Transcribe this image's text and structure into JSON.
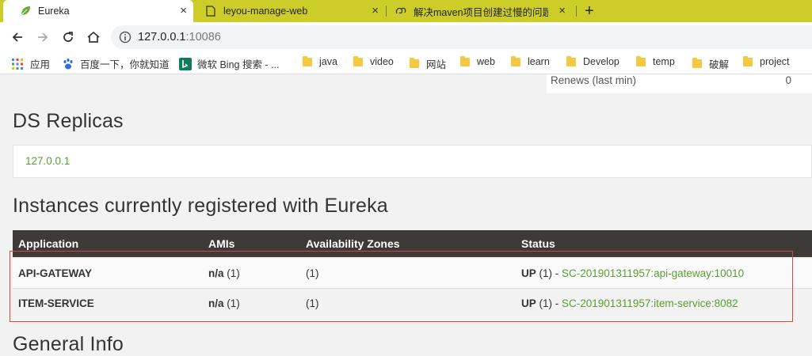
{
  "browser": {
    "tabs": [
      {
        "title": "Eureka",
        "icon": "eureka-leaf-icon",
        "active": true
      },
      {
        "title": "leyou-manage-web",
        "icon": "document-icon",
        "active": false
      },
      {
        "title": "解决maven项目创建过慢的问题",
        "icon": "swirl-icon",
        "active": false
      }
    ],
    "close_glyph": "×",
    "new_tab_glyph": "+",
    "url_host": "127.0.0.1",
    "url_port": ":10086"
  },
  "bookmarks": [
    {
      "label": "应用",
      "icon": "apps-grid-icon"
    },
    {
      "label": "百度一下，你就知道",
      "icon": "baidu-paw-icon"
    },
    {
      "label": "微软 Bing 搜索 - ...",
      "icon": "bing-icon"
    },
    {
      "label": "java",
      "icon": "folder-icon"
    },
    {
      "label": "video",
      "icon": "folder-icon"
    },
    {
      "label": "网站",
      "icon": "folder-icon"
    },
    {
      "label": "web",
      "icon": "folder-icon"
    },
    {
      "label": "learn",
      "icon": "folder-icon"
    },
    {
      "label": "Develop",
      "icon": "folder-icon"
    },
    {
      "label": "temp",
      "icon": "folder-icon"
    },
    {
      "label": "破解",
      "icon": "folder-icon"
    },
    {
      "label": "project",
      "icon": "folder-icon"
    }
  ],
  "stats": {
    "label": "Renews (last min)",
    "value": "0"
  },
  "replicas": {
    "title": "DS Replicas",
    "link": "127.0.0.1"
  },
  "instances": {
    "title": "Instances currently registered with Eureka",
    "headers": [
      "Application",
      "AMIs",
      "Availability Zones",
      "Status"
    ],
    "rows": [
      {
        "app": "API-GATEWAY",
        "ami": "n/a",
        "ami_count": " (1)",
        "zones": "(1)",
        "status": "UP",
        "status_count": " (1) - ",
        "instance": "SC-201901311957:api-gateway:10010"
      },
      {
        "app": "ITEM-SERVICE",
        "ami": "n/a",
        "ami_count": " (1)",
        "zones": "(1)",
        "status": "UP",
        "status_count": " (1) - ",
        "instance": "SC-201901311957:item-service:8082"
      }
    ]
  },
  "general": {
    "title": "General Info"
  },
  "colors": {
    "tab_bar": "#cdcd29",
    "link_green": "#5a9e2f",
    "table_header": "#3e3a37",
    "highlight": "#d04545"
  }
}
